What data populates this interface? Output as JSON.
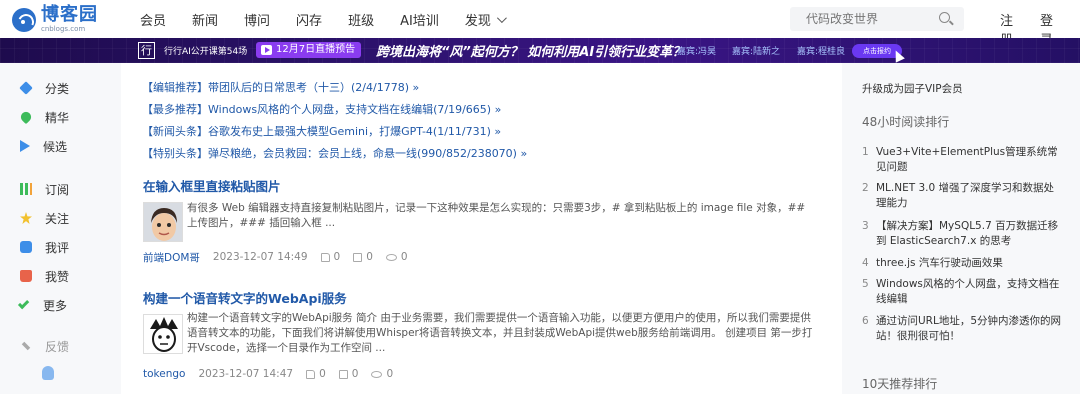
{
  "header": {
    "logo_name": "博客园",
    "logo_domain": "cnblogs.com",
    "nav": [
      "会员",
      "新闻",
      "博问",
      "闪存",
      "班级",
      "AI培训",
      "发现"
    ],
    "search_placeholder": "代码改变世界",
    "register": "注册",
    "login": "登录"
  },
  "banner": {
    "square": "行",
    "series": "行行AI公开课第54场",
    "live": "12月7日直播预告",
    "headline": "跨境出海将“风”起何方？ 如何利用AI引领行业变革？",
    "guests": [
      "嘉宾:冯昊",
      "嘉宾:陆新之",
      "嘉宾:程桂良"
    ],
    "button": "点击报约"
  },
  "sidebar": {
    "items": [
      "分类",
      "精华",
      "候选",
      "订阅",
      "关注",
      "我评",
      "我赞",
      "更多",
      "反馈"
    ]
  },
  "recommendations": [
    "【编辑推荐】带团队后的日常思考（十三）(2/4/1778) »",
    "【最多推荐】Windows风格的个人网盘，支持文档在线编辑(7/19/665) »",
    "【新闻头条】谷歌发布史上最强大模型Gemini，打爆GPT-4(1/11/731) »",
    "【特别头条】弹尽粮绝，会员救园：会员上线，命悬一线(990/852/238070) »"
  ],
  "posts": [
    {
      "title": "在输入框里直接粘贴图片",
      "summary": "有很多 Web 编辑器支持直接复制粘贴图片，记录一下这种效果是怎么实现的：只需要3步，# 拿到粘贴板上的 image file 对象，## 上传图片，### 插回输入框 ...",
      "author": "前端DOM哥",
      "date": "2023-12-07 14:49",
      "digg": "0",
      "comments": "0",
      "views": "0"
    },
    {
      "title": "构建一个语音转文字的WebApi服务",
      "summary": "构建一个语音转文字的WebApi服务 简介 由于业务需要，我们需要提供一个语音输入功能，以便更方便用户的使用，所以我们需要提供语音转文本的功能，下面我们将讲解使用Whisper将语音转换文本，并且封装成WebApi提供web服务给前端调用。 创建项目 第一步打开Vscode，选择一个目录作为工作空间 ...",
      "author": "tokengo",
      "date": "2023-12-07 14:47",
      "digg": "0",
      "comments": "0",
      "views": "0"
    }
  ],
  "rightcol": {
    "vip": "升级成为园子VIP会员",
    "rank_title": "48小时阅读排行",
    "rank": [
      "Vue3+Vite+ElementPlus管理系统常见问题",
      "ML.NET 3.0 增强了深度学习和数据处理能力",
      "【解决方案】MySQL5.7 百万数据迁移到 ElasticSearch7.x 的思考",
      "three.js 汽车行驶动画效果",
      "Windows风格的个人网盘，支持文档在线编辑",
      "通过访问URL地址，5分钟内渗透你的网站！很刑很可怕！"
    ],
    "rank2_title": "10天推荐排行"
  }
}
